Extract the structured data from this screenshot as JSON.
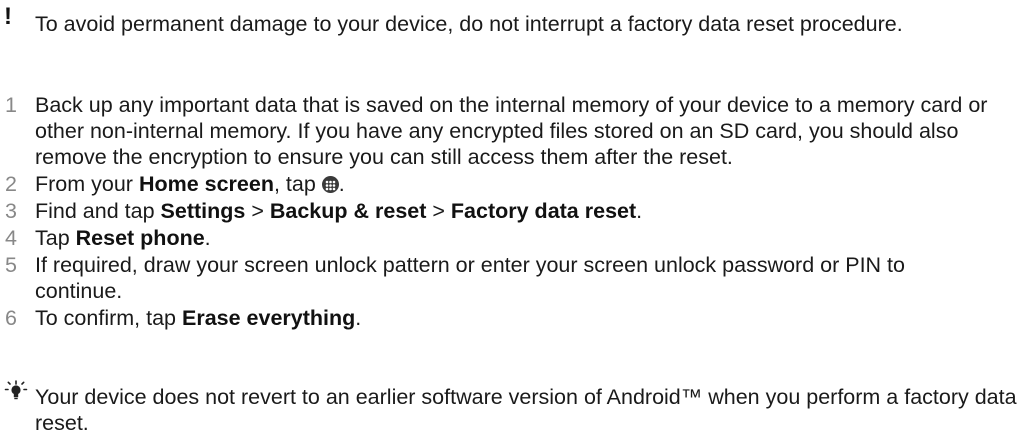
{
  "warning": {
    "icon": "exclamation-icon",
    "text": "To avoid permanent damage to your device, do not interrupt a factory data reset procedure."
  },
  "steps": [
    {
      "number": "1",
      "text": "Back up any important data that is saved on the internal memory of your device to a memory card or other non-internal memory. If you have any encrypted files stored on an SD card, you should also remove the encryption to ensure you can still access them after the reset."
    },
    {
      "number": "2",
      "pre": "From your ",
      "bold": "Home screen",
      "post": ", tap ",
      "icon": "apps-grid-icon",
      "end": "."
    },
    {
      "number": "3",
      "pre": "Find and tap ",
      "b1": "Settings",
      "sep1": " > ",
      "b2": "Backup & reset",
      "sep2": " > ",
      "b3": "Factory data reset",
      "end": "."
    },
    {
      "number": "4",
      "pre": "Tap ",
      "bold": "Reset phone",
      "end": "."
    },
    {
      "number": "5",
      "text": "If required, draw your screen unlock pattern or enter your screen unlock password or PIN to continue."
    },
    {
      "number": "6",
      "pre": "To confirm, tap ",
      "bold": "Erase everything",
      "end": "."
    }
  ],
  "tip": {
    "icon": "lightbulb-tip-icon",
    "text": "Your device does not revert to an earlier software version of Android™ when you perform a factory data reset."
  }
}
